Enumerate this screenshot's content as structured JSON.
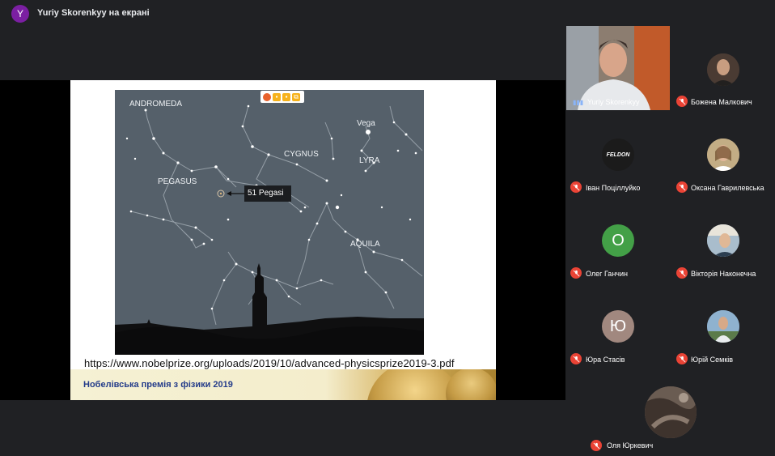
{
  "presenter": {
    "initial": "Y",
    "title": "Yuriy Skorenkyy на екрані"
  },
  "share_controls": {
    "items": [
      "firefox-icon",
      "camera-icon",
      "mic-icon",
      "share-icon"
    ]
  },
  "slide": {
    "url": "https://www.nobelprize.org/uploads/2019/10/advanced-physicsprize2019-3.pdf",
    "footer_title": "Нобелівська премія з фізики 2019",
    "starmap_labels": {
      "andromeda": "ANDROMEDA",
      "pegasus": "PEGASUS",
      "cygnus": "CYGNUS",
      "vega": "Vega",
      "lyra": "LYRA",
      "aquila": "AQUILA",
      "pegasi": "51 Pegasi"
    }
  },
  "participants": [
    {
      "name": "Yuriy Skorenkyy",
      "muted": false,
      "avatar": "video"
    },
    {
      "name": "Божена Малкович",
      "muted": true,
      "avatar": "photo"
    },
    {
      "name": "Іван Поціллуйко",
      "muted": true,
      "avatar": "FELDON"
    },
    {
      "name": "Оксана Гаврилевська",
      "muted": true,
      "avatar": "photo"
    },
    {
      "name": "Олег Ганчин",
      "muted": true,
      "avatar": "О",
      "color": "#43a047"
    },
    {
      "name": "Вікторія Наконечна",
      "muted": true,
      "avatar": "photo"
    },
    {
      "name": "Юра Стасів",
      "muted": true,
      "avatar": "Ю",
      "color": "#a1887f"
    },
    {
      "name": "Юрій Семків",
      "muted": true,
      "avatar": "photo"
    },
    {
      "name": "Оля Юркевич",
      "muted": true,
      "avatar": "photo"
    }
  ],
  "colors": {
    "mic_off": "#ea4335",
    "accent_presenter": "#7b1fa2"
  }
}
